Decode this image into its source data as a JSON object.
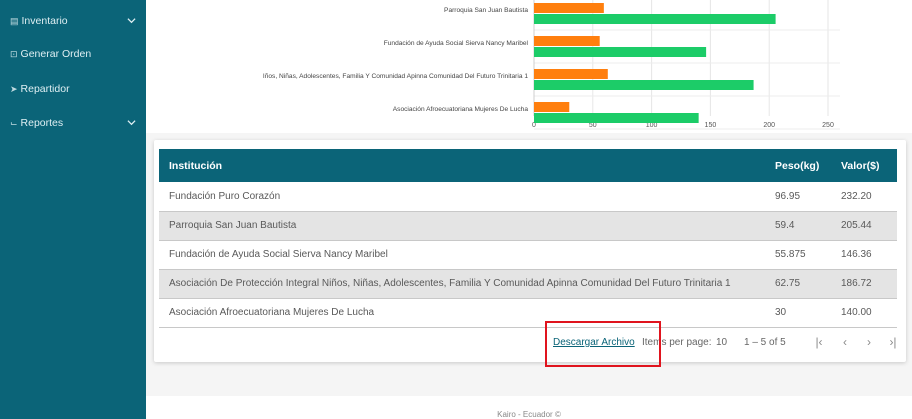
{
  "sidebar": {
    "items": [
      {
        "icon": "warehouse-icon",
        "icon_glyph": "▤",
        "label": "Inventario",
        "expandable": true
      },
      {
        "icon": "order-icon",
        "icon_glyph": "⊡",
        "label": "Generar Orden",
        "expandable": false
      },
      {
        "icon": "send-icon",
        "icon_glyph": "➤",
        "label": "Repartidor",
        "expandable": false
      },
      {
        "icon": "chart-icon",
        "icon_glyph": "⌙",
        "label": "Reportes",
        "expandable": true
      }
    ],
    "chevron_glyph": "⌄"
  },
  "chart_data": {
    "type": "bar",
    "orientation": "horizontal",
    "categories": [
      "Parroquia San Juan Bautista",
      "Fundación de Ayuda Social Sierva Nancy Maribel",
      "Iños, Niñas, Adolescentes, Familia Y Comunidad Apinna Comunidad Del Futuro Trinitaria 1",
      "Asociación Afroecuatoriana Mujeres De Lucha"
    ],
    "series": [
      {
        "color": "#ff7f0e",
        "values": [
          59.4,
          55.875,
          62.75,
          30
        ]
      },
      {
        "color": "#1ccc68",
        "values": [
          205.44,
          146.36,
          186.72,
          140
        ]
      }
    ],
    "xlim": [
      0,
      250
    ],
    "xticks": [
      "0",
      "50",
      "100",
      "150",
      "200",
      "250"
    ],
    "grid": true
  },
  "table": {
    "headers": [
      "Institución",
      "Peso(kg)",
      "Valor($)"
    ],
    "rows": [
      [
        "Fundación Puro Corazón",
        "96.95",
        "232.20"
      ],
      [
        "Parroquia San Juan Bautista",
        "59.4",
        "205.44"
      ],
      [
        "Fundación de Ayuda Social Sierva Nancy Maribel",
        "55.875",
        "146.36"
      ],
      [
        "Asociación De Protección Integral Niños, Niñas, Adolescentes, Familia Y Comunidad Apinna Comunidad Del Futuro Trinitaria 1",
        "62.75",
        "186.72"
      ],
      [
        "Asociación Afroecuatoriana Mujeres De Lucha",
        "30",
        "140.00"
      ]
    ]
  },
  "paginator": {
    "download_label": "Descargar Archivo",
    "items_per_page_label": "Items per page:",
    "items_per_page_value": "10",
    "range_label": "1 – 5 of 5",
    "first_glyph": "|‹",
    "prev_glyph": "‹",
    "next_glyph": "›",
    "last_glyph": "›|"
  },
  "highlight_color": "#e0141e",
  "accent_color": "#0b6478",
  "footer": {
    "text": "Kairo - Ecuador ©"
  }
}
